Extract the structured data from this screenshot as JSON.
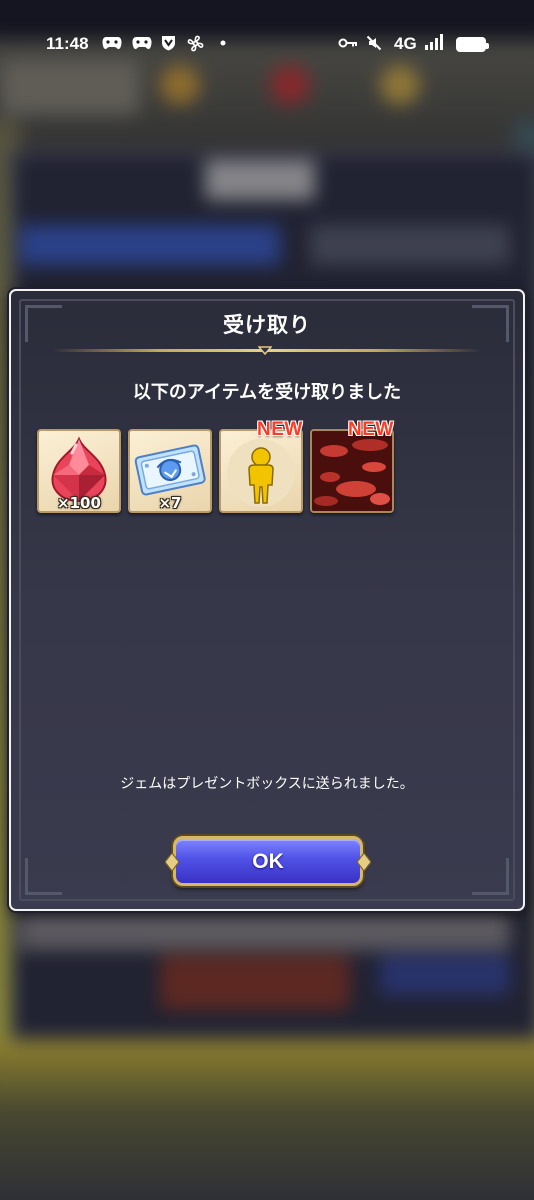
{
  "status_bar": {
    "time": "11:48",
    "network": "4G",
    "icons": [
      "game-controller-icon",
      "game-controller-icon",
      "shield-icon",
      "fan-icon",
      "dot-icon",
      "key-icon",
      "mute-icon",
      "signal-icon",
      "battery-icon"
    ]
  },
  "dialog": {
    "title": "受け取り",
    "subtitle": "以下のアイテムを受け取りました",
    "note": "ジェムはプレゼントボックスに送られました。",
    "ok_label": "OK",
    "items": [
      {
        "icon": "ruby-gem-icon",
        "quantity": "×100",
        "badge": ""
      },
      {
        "icon": "blue-ticket-icon",
        "quantity": "×7",
        "badge": ""
      },
      {
        "icon": "gold-avatar-icon",
        "quantity": "",
        "badge": "NEW"
      },
      {
        "icon": "red-background-icon",
        "quantity": "",
        "badge": "NEW"
      }
    ]
  },
  "colors": {
    "button_blue": "#4f52e6",
    "button_border": "#d8b867",
    "new_badge": "#ff3b24",
    "dialog_bg": "#363748"
  }
}
